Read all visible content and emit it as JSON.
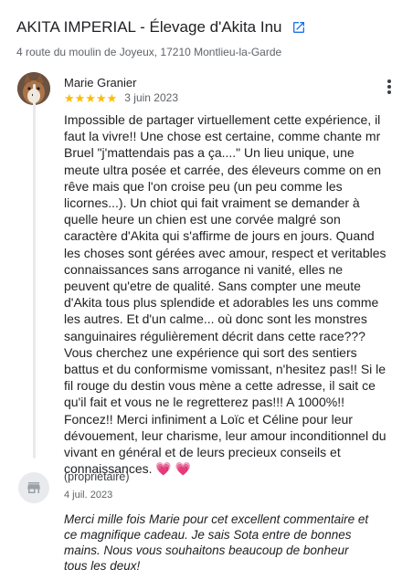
{
  "place": {
    "title": "AKITA IMPERIAL - Élevage d'Akita Inu",
    "address": "4 route du moulin de Joyeux, 17210 Montlieu-la-Garde"
  },
  "review": {
    "author": "Marie Granier",
    "stars": "★★★★★",
    "rating": 5,
    "date": "3 juin 2023",
    "text": "Impossible de partager virtuellement cette expérience, il faut la vivre!! Une chose est certaine, comme chante mr Bruel \"j'mattendais pas a ça....\" Un lieu unique, une meute ultra posée et carrée, des éleveurs comme on en rêve mais que l'on croise peu (un peu comme les licornes...). Un chiot qui fait vraiment se demander à quelle heure un chien est une corvée malgré son caractère d'Akita qui s'affirme de jours en jours. Quand les choses sont gérées avec amour, respect et veritables connaissances sans arrogance ni vanité, elles ne peuvent qu'etre de qualité. Sans compter une meute d'Akita tous plus splendide et adorables les uns comme les autres. Et d'un calme... où donc sont les monstres sanguinaires régulièrement décrit dans cette race??? Vous cherchez une expérience qui sort des sentiers battus et du conformisme vomissant, n'hesitez pas!! Si le fil rouge du destin vous mène a cette adresse, il sait ce qu'il fait et vous ne le regretterez pas!!! A 1000%!! Foncez!! Merci infiniment a Loïc et Céline pour leur dévouement, leur charisme, leur amour inconditionnel du vivant en général et de leurs precieux conseils et connaissances.",
    "emoji": "💗 💗"
  },
  "owner_reply": {
    "label": "(propriétaire)",
    "date": "4 juil. 2023",
    "text": "Merci mille fois Marie pour cet excellent commentaire et ce magnifique cadeau. Je sais Sota entre de bonnes mains. Nous vous souhaitons beaucoup de bonheur tous les deux!"
  },
  "colors": {
    "star": "#fbbc04",
    "link_icon": "#1a73e8",
    "heart": "#e8315b"
  }
}
